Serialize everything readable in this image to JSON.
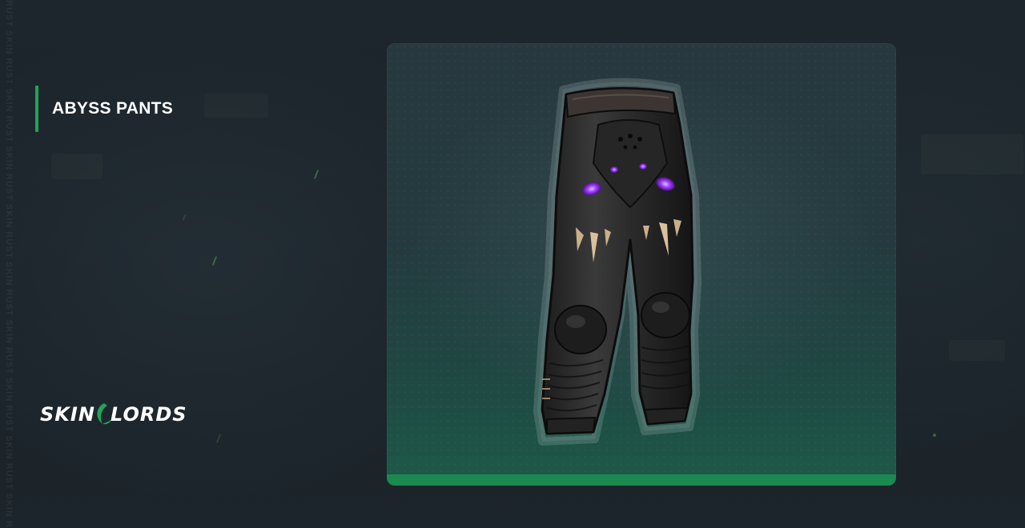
{
  "page": {
    "item_title": "ABYSS PANTS",
    "brand_logo_text": "SKINLORDS",
    "edge_text": "RUST SKIN RUST SKIN RUST SKIN RUST SKIN RUST SKIN RUST SKIN RUST SKIN RUST SKIN RUST SKIN RUST SKIN",
    "item_image": "abyss-pants-image"
  },
  "colors": {
    "background": "#1b2329",
    "accent": "#1fa35a",
    "card_strip": "#1a8a50",
    "title_text": "#ffffff",
    "glow_eyes": "#9b3cff"
  }
}
